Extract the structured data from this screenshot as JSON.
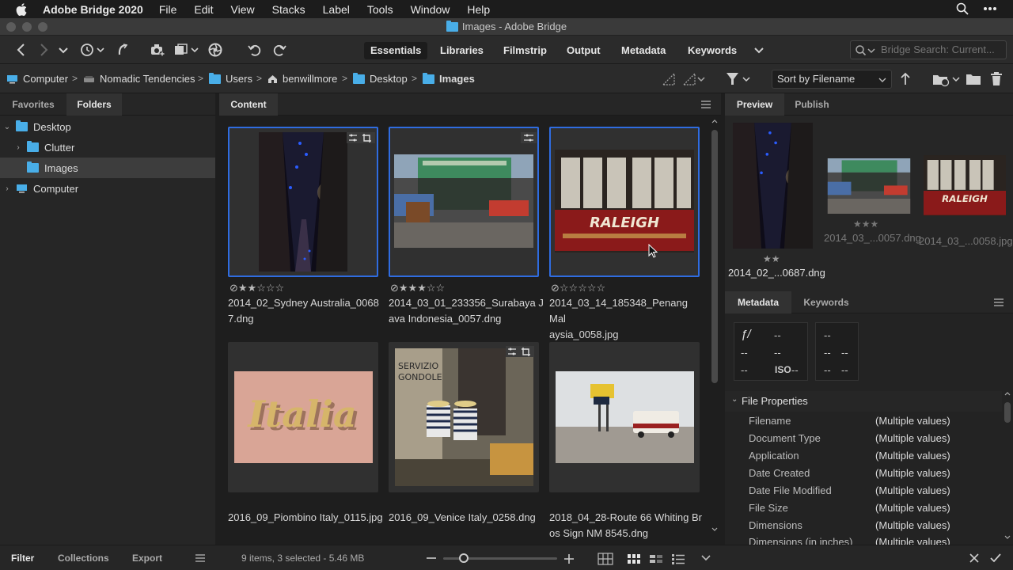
{
  "menubar": {
    "app_name": "Adobe Bridge 2020",
    "items": [
      "File",
      "Edit",
      "View",
      "Stacks",
      "Label",
      "Tools",
      "Window",
      "Help"
    ]
  },
  "window": {
    "title": "Images - Adobe Bridge"
  },
  "toolbar": {
    "workspaces": [
      "Essentials",
      "Libraries",
      "Filmstrip",
      "Output",
      "Metadata",
      "Keywords"
    ],
    "active_workspace": "Essentials",
    "search_placeholder": "Bridge Search: Current..."
  },
  "pathbar": {
    "crumbs": [
      "Computer",
      "Nomadic Tendencies",
      "Users",
      "benwillmore",
      "Desktop",
      "Images"
    ],
    "sort_label": "Sort by Filename"
  },
  "left_panel": {
    "tabs": [
      "Favorites",
      "Folders"
    ],
    "active_tab": "Folders",
    "tree": [
      {
        "label": "Desktop",
        "level": 0,
        "expanded": true
      },
      {
        "label": "Clutter",
        "level": 1,
        "expanded": false
      },
      {
        "label": "Images",
        "level": 1,
        "selected": true
      },
      {
        "label": "Computer",
        "level": 0,
        "expanded": false
      }
    ]
  },
  "content_panel": {
    "tab": "Content",
    "items": [
      {
        "name_line1": "2014_02_Sydney Australia_0068",
        "name_line2": "7.dng",
        "rating": 2,
        "selected": true
      },
      {
        "name_line1": "2014_03_01_233356_Surabaya J",
        "name_line2": "ava Indonesia_0057.dng",
        "rating": 3,
        "selected": true
      },
      {
        "name_line1": "2014_03_14_185348_Penang Mal",
        "name_line2": "aysia_0058.jpg",
        "rating": 0,
        "selected": true
      },
      {
        "name_line1": "2016_09_Piombino Italy_0115.jpg",
        "name_line2": "",
        "selected": false
      },
      {
        "name_line1": "2016_09_Venice Italy_0258.dng",
        "name_line2": "",
        "selected": false
      },
      {
        "name_line1": "2018_04_28-Route 66 Whiting Br",
        "name_line2": "os Sign NM 8545.dng",
        "selected": false
      }
    ],
    "status": "9 items, 3 selected - 5.46 MB"
  },
  "preview_panel": {
    "tabs": [
      "Preview",
      "Publish"
    ],
    "active_tab": "Preview",
    "captions": [
      "2014_02_...0687.dng",
      "2014_03_...0057.dng",
      "2014_03_...0058.jpg"
    ]
  },
  "metadata_panel": {
    "tabs": [
      "Metadata",
      "Keywords"
    ],
    "active_tab": "Metadata",
    "placard": {
      "aperture_symbol": "ƒ/",
      "dash": "--",
      "iso": "ISO"
    },
    "section_title": "File Properties",
    "rows": [
      {
        "label": "Filename",
        "value": "(Multiple values)"
      },
      {
        "label": "Document Type",
        "value": "(Multiple values)"
      },
      {
        "label": "Application",
        "value": "(Multiple values)"
      },
      {
        "label": "Date Created",
        "value": "(Multiple values)"
      },
      {
        "label": "Date File Modified",
        "value": "(Multiple values)"
      },
      {
        "label": "File Size",
        "value": "(Multiple values)"
      },
      {
        "label": "Dimensions",
        "value": "(Multiple values)"
      },
      {
        "label": "Dimensions (in inches)",
        "value": "(Multiple values)"
      }
    ]
  },
  "bottom_tabs": [
    "Filter",
    "Collections",
    "Export"
  ],
  "colors": {
    "accent_blue": "#2f6ce0",
    "folder_blue": "#49aee8",
    "panel_bg": "#262626"
  }
}
